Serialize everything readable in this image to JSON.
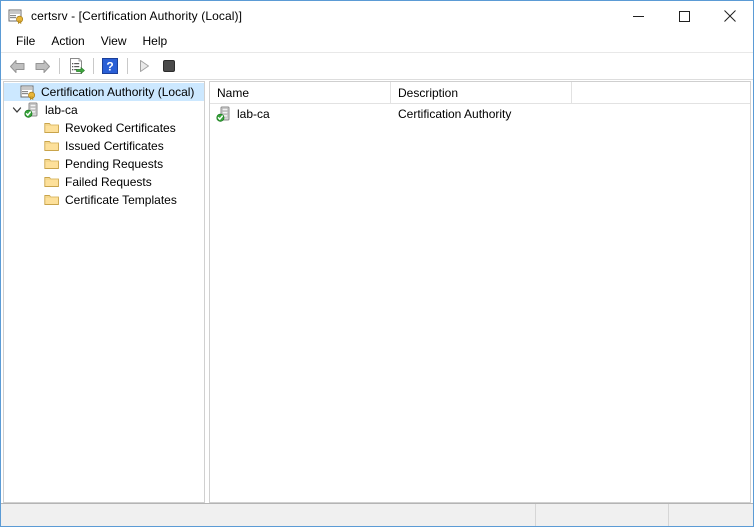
{
  "window": {
    "title": "certsrv - [Certification Authority (Local)]",
    "title_icon": "certification-authority-console-icon",
    "caption": {
      "minimize_label": "Minimize",
      "maximize_label": "Maximize",
      "close_label": "Close"
    }
  },
  "menubar": {
    "items": [
      {
        "label": "File",
        "name": "menu-file"
      },
      {
        "label": "Action",
        "name": "menu-action"
      },
      {
        "label": "View",
        "name": "menu-view"
      },
      {
        "label": "Help",
        "name": "menu-help"
      }
    ]
  },
  "toolbar": {
    "buttons": [
      {
        "name": "back-button",
        "icon": "back-arrow-icon",
        "enabled": false
      },
      {
        "name": "forward-button",
        "icon": "forward-arrow-icon",
        "enabled": false
      },
      {
        "name": "show-console-tree-button",
        "icon": "console-tree-icon",
        "enabled": true
      },
      {
        "name": "help-button",
        "icon": "help-question-icon",
        "enabled": true
      },
      {
        "name": "start-service-button",
        "icon": "play-triangle-icon",
        "enabled": false
      },
      {
        "name": "stop-service-button",
        "icon": "stop-square-icon",
        "enabled": true
      }
    ]
  },
  "tree": {
    "nodes": [
      {
        "label": "Certification Authority (Local)",
        "icon": "console-root-icon",
        "level": 0,
        "selected": true,
        "expandable": false
      },
      {
        "label": "lab-ca",
        "icon": "ca-server-running-icon",
        "level": 1,
        "selected": false,
        "expandable": true,
        "expanded": true
      },
      {
        "label": "Revoked Certificates",
        "icon": "folder-icon",
        "level": 2,
        "selected": false,
        "expandable": false
      },
      {
        "label": "Issued Certificates",
        "icon": "folder-icon",
        "level": 2,
        "selected": false,
        "expandable": false
      },
      {
        "label": "Pending Requests",
        "icon": "folder-icon",
        "level": 2,
        "selected": false,
        "expandable": false
      },
      {
        "label": "Failed Requests",
        "icon": "folder-icon",
        "level": 2,
        "selected": false,
        "expandable": false
      },
      {
        "label": "Certificate Templates",
        "icon": "folder-icon",
        "level": 2,
        "selected": false,
        "expandable": false
      }
    ]
  },
  "list": {
    "columns": [
      {
        "label": "Name",
        "name": "column-header-name"
      },
      {
        "label": "Description",
        "name": "column-header-description"
      }
    ],
    "rows": [
      {
        "icon": "ca-server-running-icon",
        "name": "lab-ca",
        "description": "Certification Authority"
      }
    ]
  },
  "statusbar": {
    "main_text": "",
    "pane_a_text": "",
    "pane_b_text": ""
  },
  "colors": {
    "selection": "#cce8ff",
    "window_border": "#5b9bd5",
    "statusbar_bg": "#f0f0f0",
    "folder_yellow": "#fde09a",
    "help_blue": "#2a5fd6",
    "ok_green": "#37a63a",
    "disabled_gray": "#a8a8a8"
  }
}
